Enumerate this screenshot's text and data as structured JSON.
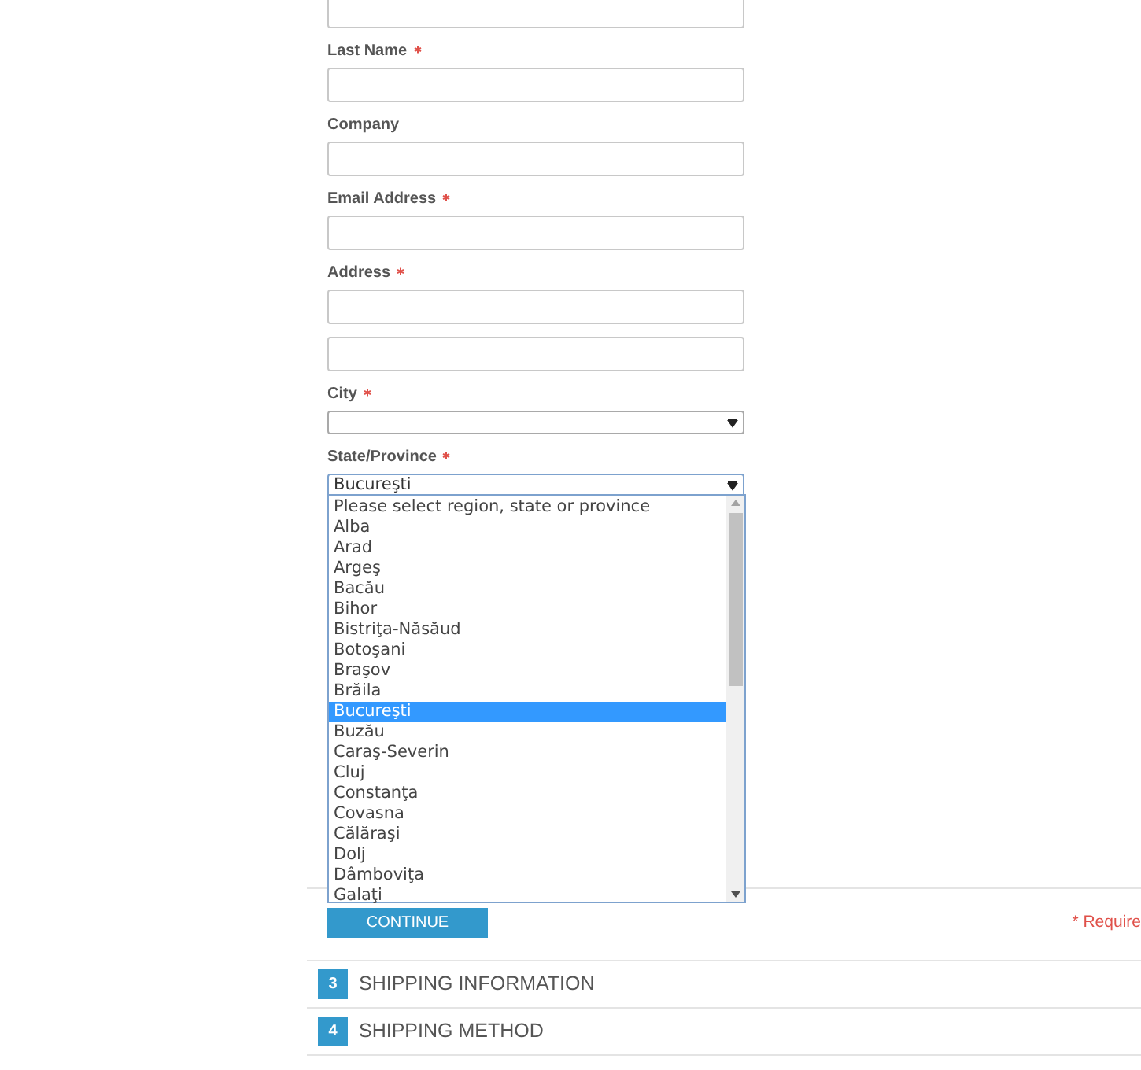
{
  "fields": [
    {
      "kind": "text"
    },
    {
      "kind": "text",
      "label": "Last Name",
      "required": true
    },
    {
      "kind": "text",
      "label": "Company",
      "required": false
    },
    {
      "kind": "text",
      "label": "Email Address",
      "required": true
    },
    {
      "kind": "text",
      "label": "Address",
      "required": true
    },
    {
      "kind": "text"
    },
    {
      "kind": "select",
      "label": "City",
      "required": true
    },
    {
      "kind": "select",
      "label": "State/Province",
      "required": true,
      "value": "Bucureşti",
      "open": true
    }
  ],
  "dropdown": {
    "options": [
      {
        "label": "Please select region, state or province",
        "selected": false
      },
      {
        "label": "Alba",
        "selected": false
      },
      {
        "label": "Arad",
        "selected": false
      },
      {
        "label": "Argeş",
        "selected": false
      },
      {
        "label": "Bacău",
        "selected": false
      },
      {
        "label": "Bihor",
        "selected": false
      },
      {
        "label": "Bistriţa-Năsăud",
        "selected": false
      },
      {
        "label": "Botoşani",
        "selected": false
      },
      {
        "label": "Braşov",
        "selected": false
      },
      {
        "label": "Brăila",
        "selected": false
      },
      {
        "label": "Bucureşti",
        "selected": true
      },
      {
        "label": "Buzău",
        "selected": false
      },
      {
        "label": "Caraş-Severin",
        "selected": false
      },
      {
        "label": "Cluj",
        "selected": false
      },
      {
        "label": "Constanţa",
        "selected": false
      },
      {
        "label": "Covasna",
        "selected": false
      },
      {
        "label": "Călăraşi",
        "selected": false
      },
      {
        "label": "Dolj",
        "selected": false
      },
      {
        "label": "Dâmboviţa",
        "selected": false
      },
      {
        "label": "Galaţi",
        "selected": false
      }
    ]
  },
  "continue_button": "CONTINUE",
  "required_note": "* Require",
  "sections": [
    {
      "number": "3",
      "title": "SHIPPING INFORMATION"
    },
    {
      "number": "4",
      "title": "SHIPPING METHOD"
    }
  ]
}
